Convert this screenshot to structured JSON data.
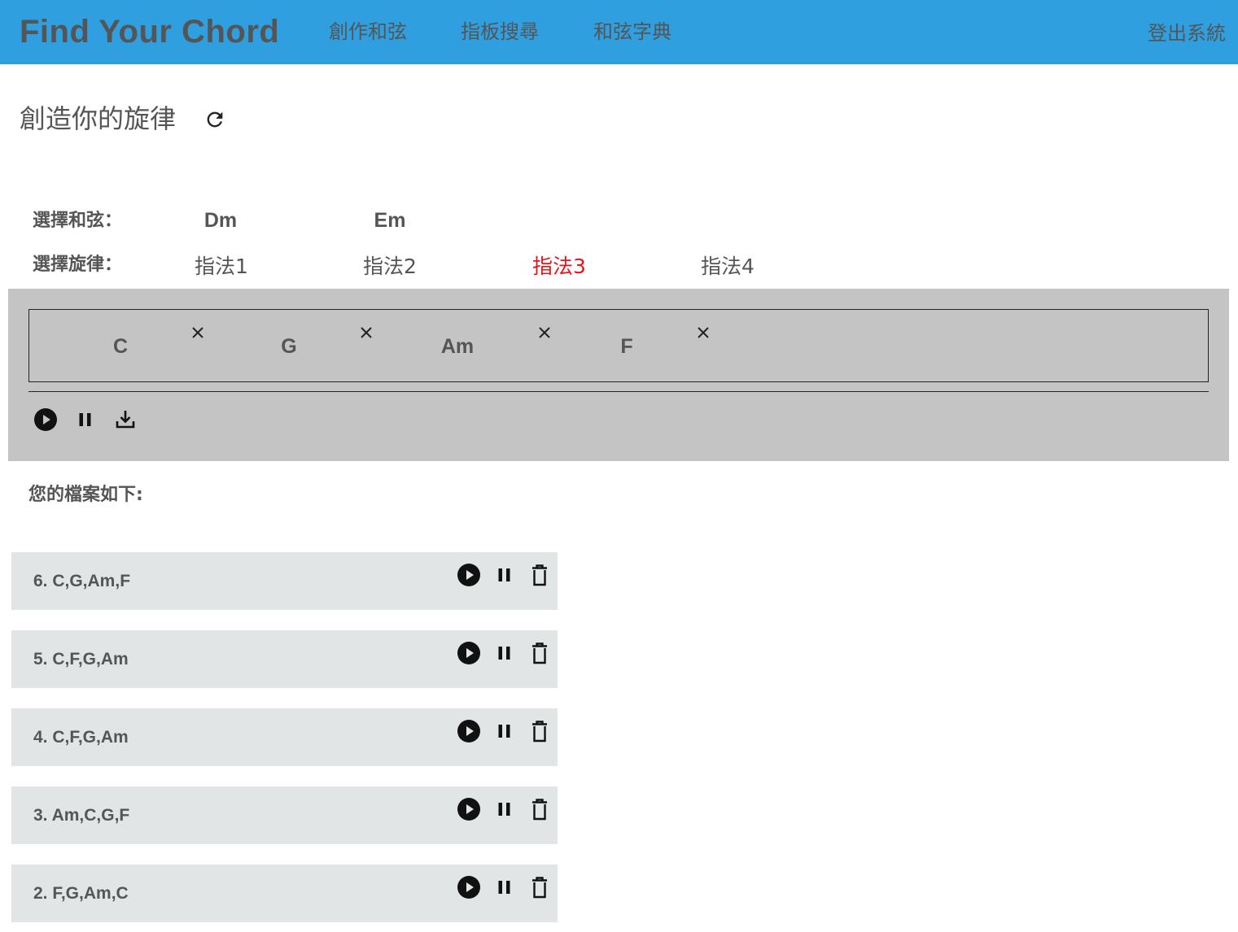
{
  "nav": {
    "brand": "Find Your Chord",
    "links": [
      "創作和弦",
      "指板搜尋",
      "和弦字典"
    ],
    "logout": "登出系統"
  },
  "page": {
    "title": "創造你的旋律",
    "refresh_icon": "refresh-icon"
  },
  "chord_select": {
    "label": "選擇和弦：",
    "options": [
      "Dm",
      "Em"
    ]
  },
  "fingering_select": {
    "label": "選擇旋律：",
    "options": [
      "指法1",
      "指法2",
      "指法3",
      "指法4"
    ],
    "selected": "指法3",
    "selected_color": "#e8141c"
  },
  "composer": {
    "sequence": [
      "C",
      "G",
      "Am",
      "F"
    ],
    "remove_icon": "close-icon",
    "controls": [
      "play-icon",
      "pause-icon",
      "download-icon"
    ]
  },
  "files": {
    "heading": "您的檔案如下:",
    "items": [
      "6. C,G,Am,F",
      "5. C,F,G,Am",
      "4. C,F,G,Am",
      "3. Am,C,G,F",
      "2. F,G,Am,C"
    ],
    "item_icons": [
      "play-icon",
      "pause-icon",
      "trash-icon"
    ]
  },
  "colors": {
    "nav_bg": "#2f9fe0",
    "panel_bg": "#c4c4c4",
    "file_row_bg": "#e1e5e6",
    "text": "#555555",
    "active": "#e8141c"
  }
}
